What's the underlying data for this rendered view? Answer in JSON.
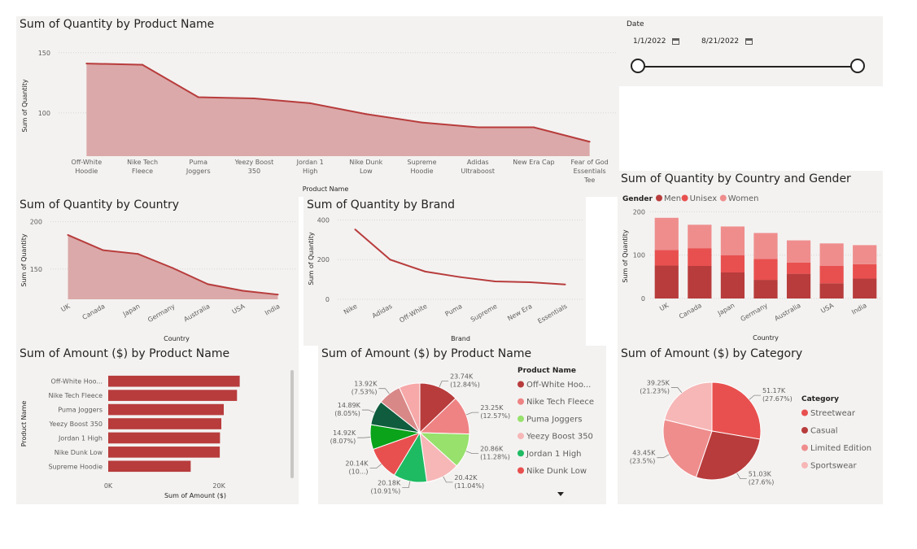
{
  "date_slicer": {
    "label": "Date",
    "start": "1/1/2022",
    "end": "8/21/2022"
  },
  "titles": {
    "p1": "Sum of Quantity by Product Name",
    "p2": "Sum of Quantity by Country",
    "p3": "Sum of Quantity by Brand",
    "p4": "Sum of Quantity by Country and Gender",
    "p5": "Sum of Amount ($) by Product Name",
    "p6": "Sum of Amount ($) by Product Name",
    "p7": "Sum of Amount ($) by Category"
  },
  "chart_data": [
    {
      "id": "qty-product",
      "type": "area",
      "title": "Sum of Quantity by Product Name",
      "xlabel": "Product Name",
      "ylabel": "Sum of Quantity",
      "categories": [
        "Off-White Hoodie",
        "Nike Tech Fleece",
        "Puma Joggers",
        "Yeezy Boost 350",
        "Jordan 1 High",
        "Nike Dunk Low",
        "Supreme Hoodie",
        "Adidas Ultraboost",
        "New Era Cap",
        "Fear of God Essentials Tee"
      ],
      "values": [
        141,
        140,
        113,
        112,
        108,
        99,
        92,
        88,
        88,
        76
      ],
      "ylim": [
        64,
        160
      ],
      "yticks": [
        100,
        150
      ],
      "color": "#b83c3c",
      "fill": "#dba9a9"
    },
    {
      "id": "qty-country",
      "type": "area",
      "title": "Sum of Quantity by Country",
      "xlabel": "Country",
      "ylabel": "Sum of Quantity",
      "categories": [
        "UK",
        "Canada",
        "Japan",
        "Germany",
        "Australia",
        "USA",
        "India"
      ],
      "values": [
        186,
        170,
        166,
        151,
        134,
        127,
        123
      ],
      "ylim": [
        118,
        204
      ],
      "yticks": [
        150,
        200
      ],
      "color": "#b83c3c",
      "fill": "#dba9a9"
    },
    {
      "id": "qty-brand",
      "type": "line",
      "title": "Sum of Quantity by Brand",
      "xlabel": "Brand",
      "ylabel": "Sum of Quantity",
      "categories": [
        "Nike",
        "Adidas",
        "Off-White",
        "Puma",
        "Supreme",
        "New Era",
        "Essentials"
      ],
      "values": [
        352,
        200,
        140,
        112,
        90,
        86,
        75
      ],
      "ylim": [
        0,
        410
      ],
      "yticks": [
        0,
        200,
        400
      ],
      "color": "#b83c3c"
    },
    {
      "id": "qty-country-gender",
      "type": "bar",
      "stacked": true,
      "title": "Sum of Quantity by Country and Gender",
      "xlabel": "Country",
      "ylabel": "Sum of Quantity",
      "legend_title": "Gender",
      "categories": [
        "UK",
        "Canada",
        "Japan",
        "Germany",
        "Australia",
        "USA",
        "India"
      ],
      "series": [
        {
          "name": "Men",
          "color": "#b83c3c",
          "values": [
            76,
            75,
            60,
            43,
            57,
            35,
            46
          ]
        },
        {
          "name": "Unisex",
          "color": "#e8504f",
          "values": [
            36,
            41,
            40,
            48,
            26,
            40,
            33
          ]
        },
        {
          "name": "Women",
          "color": "#ef8d8d",
          "values": [
            74,
            54,
            66,
            60,
            51,
            52,
            44
          ]
        }
      ],
      "ylim": [
        0,
        210
      ],
      "yticks": [
        0,
        100,
        200
      ]
    },
    {
      "id": "amount-product-bar",
      "type": "bar",
      "orientation": "horizontal",
      "title": "Sum of Amount ($) by Product Name",
      "xlabel": "Sum of Amount ($)",
      "ylabel": "Product Name",
      "categories": [
        "Off-White Hoo...",
        "Nike Tech Fleece",
        "Puma Joggers",
        "Yeezy Boost 350",
        "Jordan 1 High",
        "Nike Dunk Low",
        "Supreme Hoodie"
      ],
      "values": [
        23740,
        23250,
        20860,
        20420,
        20180,
        20140,
        14890
      ],
      "xlim": [
        0,
        26000
      ],
      "xticks": [
        {
          "v": 0,
          "label": "0K"
        },
        {
          "v": 20000,
          "label": "20K"
        }
      ],
      "color": "#b83c3c"
    },
    {
      "id": "amount-product-pie",
      "type": "pie",
      "title": "Sum of Amount ($) by Product Name",
      "legend_title": "Product Name",
      "slices": [
        {
          "name": "Off-White Hoo...",
          "value": 23740,
          "label": "23.74K (12.84%)",
          "color": "#b83c3c"
        },
        {
          "name": "Nike Tech Fleece",
          "value": 23250,
          "label": "23.25K (12.57%)",
          "color": "#ef8384"
        },
        {
          "name": "Puma Joggers",
          "value": 20860,
          "label": "20.86K (11.28%)",
          "color": "#97e16c"
        },
        {
          "name": "Yeezy Boost 350",
          "value": 20420,
          "label": "20.42K (11.04%)",
          "color": "#f7b7b7"
        },
        {
          "name": "Jordan 1 High",
          "value": 20180,
          "label": "20.18K (10.91%)",
          "color": "#1fbb63"
        },
        {
          "name": "Nike Dunk Low",
          "value": 20140,
          "label": "20.14K (10...)",
          "color": "#e8504f"
        },
        {
          "name": "",
          "value": 14920,
          "label": "14.92K (8.07%)",
          "color": "#0aa31a"
        },
        {
          "name": "",
          "value": 14890,
          "label": "14.89K (8.05%)",
          "color": "#0f5d3e"
        },
        {
          "name": "",
          "value": 13920,
          "label": "13.92K (7.53%)",
          "color": "#d98888"
        },
        {
          "name": "",
          "value": 12590,
          "label": "",
          "color": "#f7a8a8"
        }
      ]
    },
    {
      "id": "amount-category-pie",
      "type": "pie",
      "title": "Sum of Amount ($) by Category",
      "legend_title": "Category",
      "slices": [
        {
          "name": "Streetwear",
          "value": 51170,
          "label": "51.17K (27.67%)",
          "color": "#e8504f"
        },
        {
          "name": "Casual",
          "value": 51030,
          "label": "51.03K (27.6%)",
          "color": "#b83c3c"
        },
        {
          "name": "Limited Edition",
          "value": 43450,
          "label": "43.45K (23.5%)",
          "color": "#ef8d8d"
        },
        {
          "name": "Sportswear",
          "value": 39250,
          "label": "39.25K (21.23%)",
          "color": "#f7b7b7"
        }
      ]
    }
  ]
}
